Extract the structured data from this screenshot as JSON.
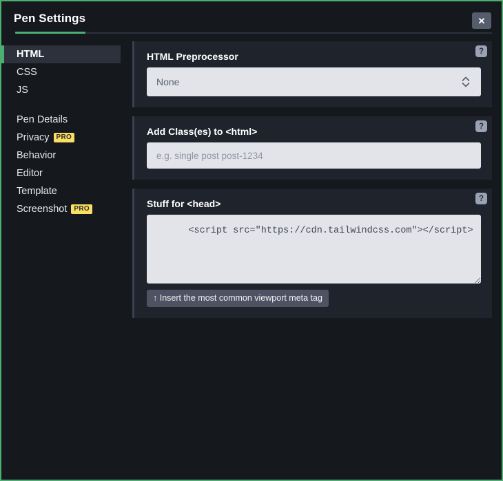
{
  "window": {
    "title": "Pen Settings",
    "accent_color": "#4caf72",
    "close_label": "✕"
  },
  "sidebar": {
    "groups": [
      {
        "items": [
          {
            "label": "HTML",
            "active": true,
            "pro": null
          },
          {
            "label": "CSS",
            "active": false,
            "pro": null
          },
          {
            "label": "JS",
            "active": false,
            "pro": null
          }
        ]
      },
      {
        "items": [
          {
            "label": "Pen Details",
            "active": false,
            "pro": null
          },
          {
            "label": "Privacy",
            "active": false,
            "pro": "PRO"
          },
          {
            "label": "Behavior",
            "active": false,
            "pro": null
          },
          {
            "label": "Editor",
            "active": false,
            "pro": null
          },
          {
            "label": "Template",
            "active": false,
            "pro": null
          },
          {
            "label": "Screenshot",
            "active": false,
            "pro": "PRO"
          }
        ]
      }
    ],
    "pro_badge_color": "#fbdf63"
  },
  "main": {
    "help_icon_label": "?",
    "preprocessor": {
      "label": "HTML Preprocessor",
      "selected": "None"
    },
    "classes": {
      "label": "Add Class(es) to <html>",
      "value": "",
      "placeholder": "e.g. single post post-1234"
    },
    "head": {
      "label": "Stuff for <head>",
      "value": "    <script src=\"https://cdn.tailwindcss.com\"></script>",
      "insert_button": "↑ Insert the most common viewport meta tag"
    }
  }
}
